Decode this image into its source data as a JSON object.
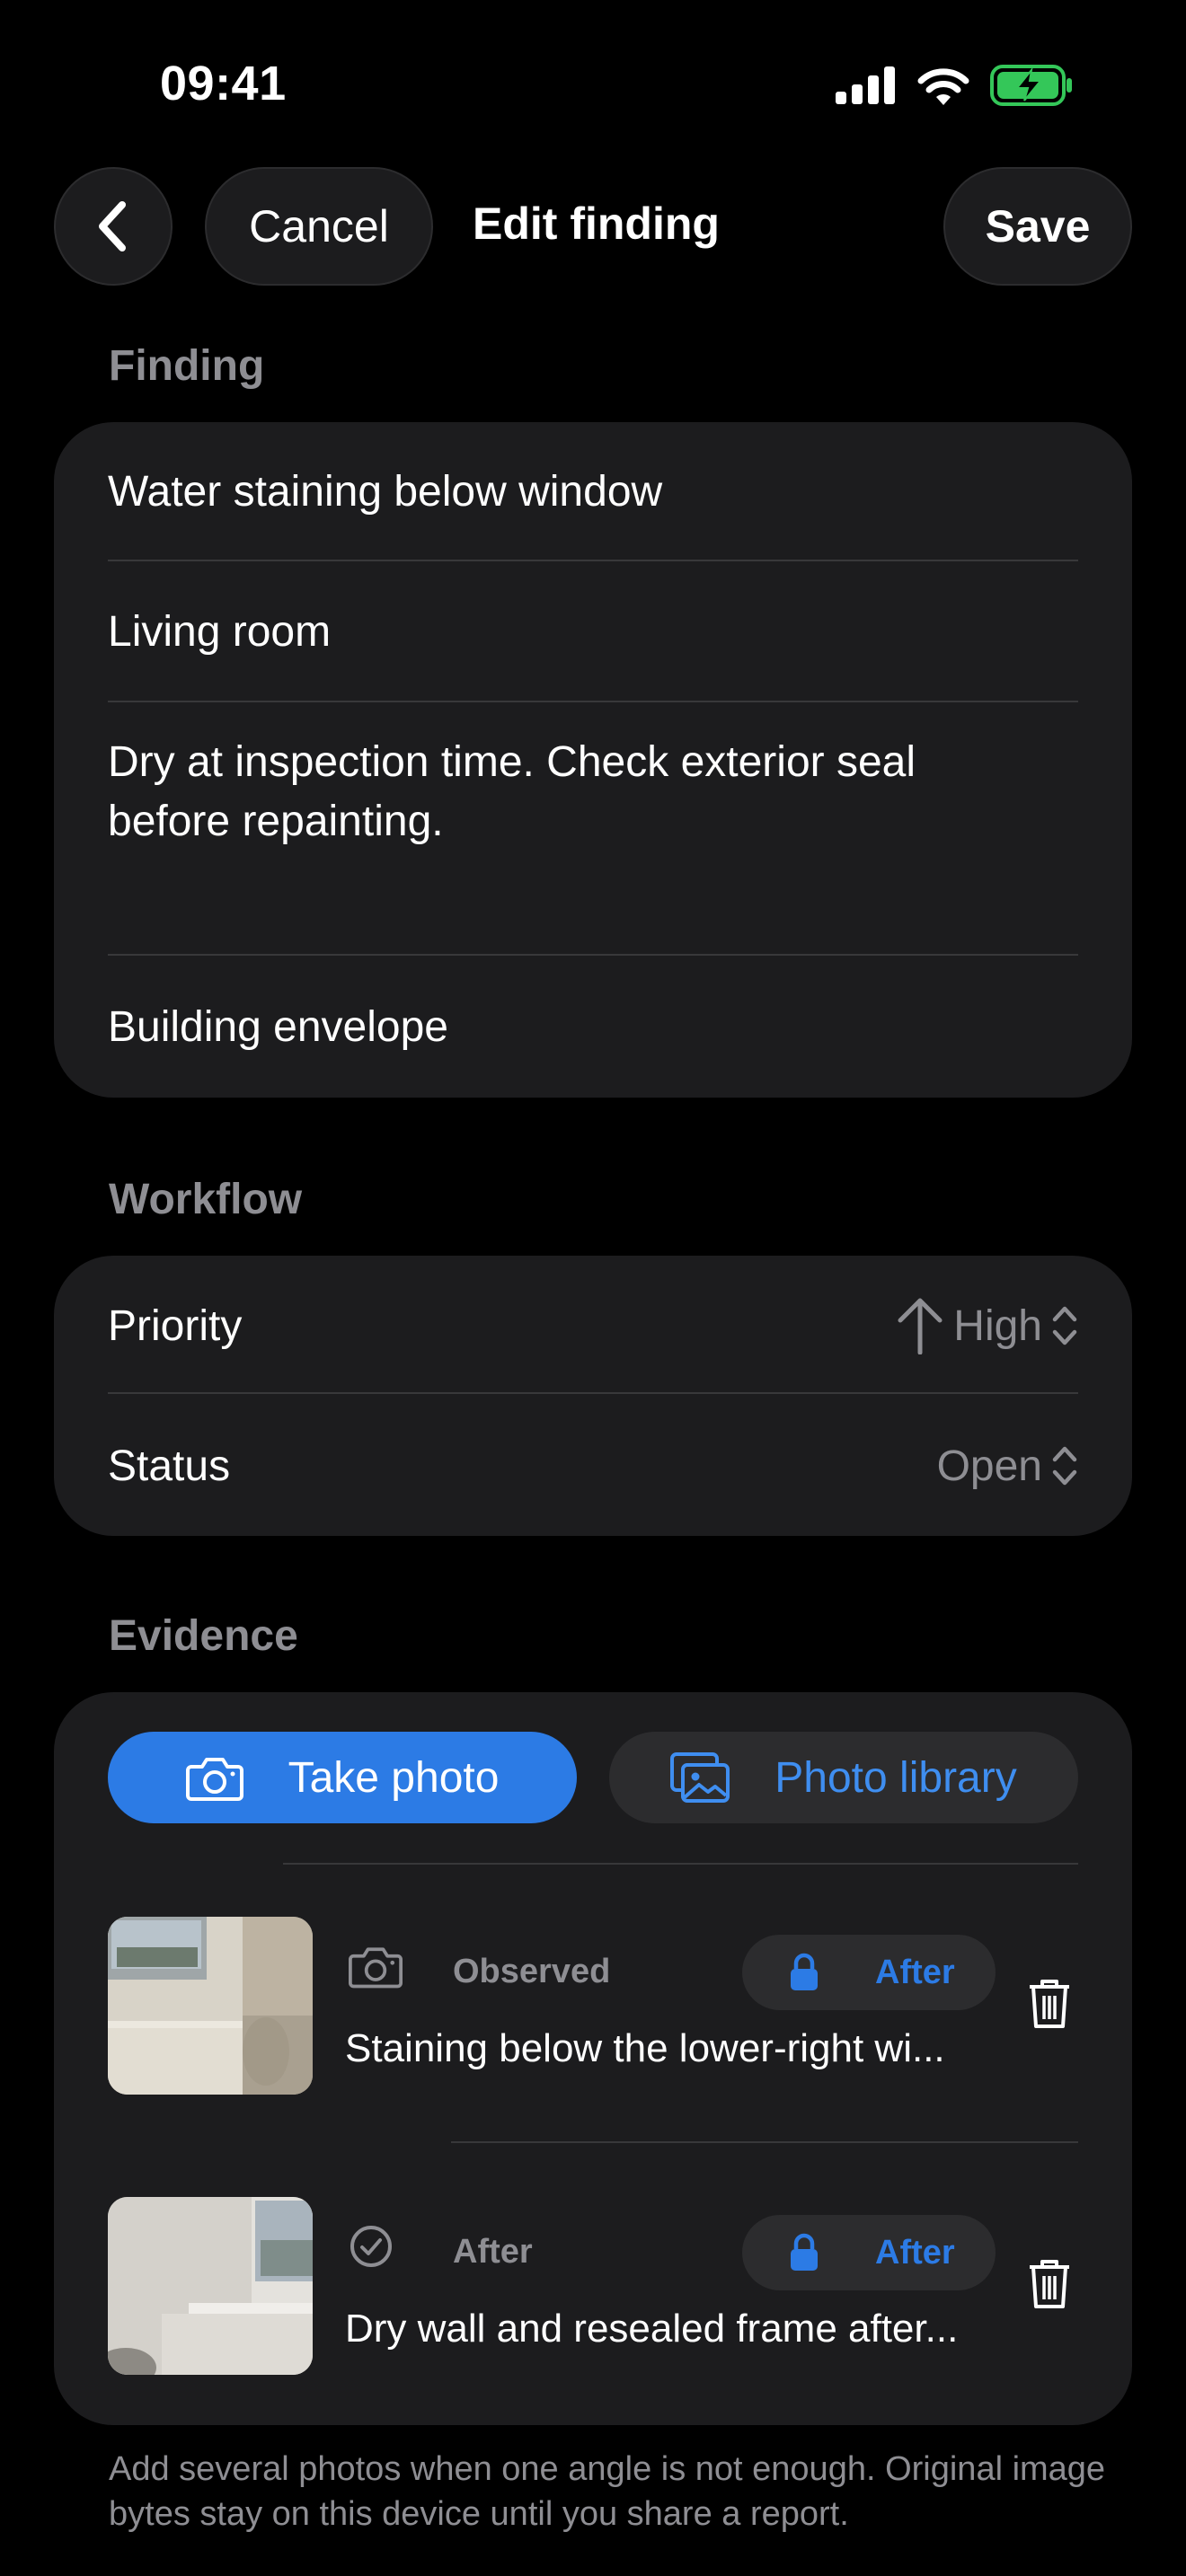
{
  "status_bar": {
    "time": "09:41"
  },
  "nav": {
    "cancel_label": "Cancel",
    "title": "Edit finding",
    "save_label": "Save"
  },
  "finding": {
    "header": "Finding",
    "title_value": "Water staining below window",
    "location_value": "Living room",
    "notes_value": "Dry at inspection time. Check exterior seal before repainting.",
    "category_value": "Building envelope"
  },
  "workflow": {
    "header": "Workflow",
    "priority_label": "Priority",
    "priority_value": "High",
    "status_label": "Status",
    "status_value": "Open"
  },
  "evidence": {
    "header": "Evidence",
    "take_photo_label": "Take photo",
    "photo_library_label": "Photo library",
    "photos": [
      {
        "kind_icon": "camera-icon",
        "kind_label": "Observed",
        "pill_label": "After",
        "caption": "Staining below the lower-right wi..."
      },
      {
        "kind_icon": "checkmark-circle-icon",
        "kind_label": "After",
        "pill_label": "After",
        "caption": "Dry wall and resealed frame after..."
      }
    ]
  },
  "footer": {
    "note": "Add several photos when one angle is not enough. Original image bytes stay on this device until you share a report."
  },
  "colors": {
    "accent": "#2c7be5",
    "card_bg": "#1c1c1e",
    "secondary_text": "#8e8e93",
    "battery": "#34c759"
  }
}
